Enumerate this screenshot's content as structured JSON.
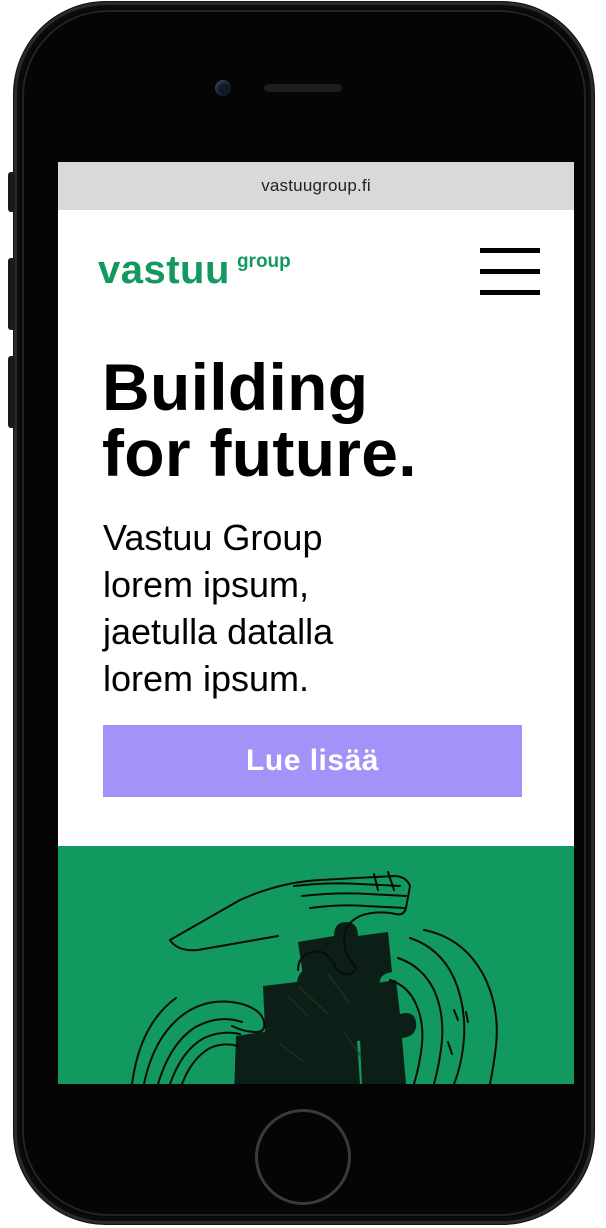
{
  "browser": {
    "url": "vastuugroup.fi"
  },
  "header": {
    "logo_main": "vastuu",
    "logo_sup": "group",
    "menu_icon": "hamburger-menu-icon"
  },
  "hero": {
    "headline_lines": [
      "Building",
      "for future."
    ],
    "description_lines": [
      "Vastuu Group",
      "lorem ipsum,",
      "jaetulla datalla",
      "lorem ipsum."
    ],
    "cta_label": "Lue lisää",
    "illustration": "hands-with-puzzle-pieces-illustration"
  },
  "colors": {
    "brand_green": "#13995e",
    "cta_purple": "#a592f8",
    "panel_green": "#12995f",
    "url_bar_gray": "#d9d9d9"
  }
}
